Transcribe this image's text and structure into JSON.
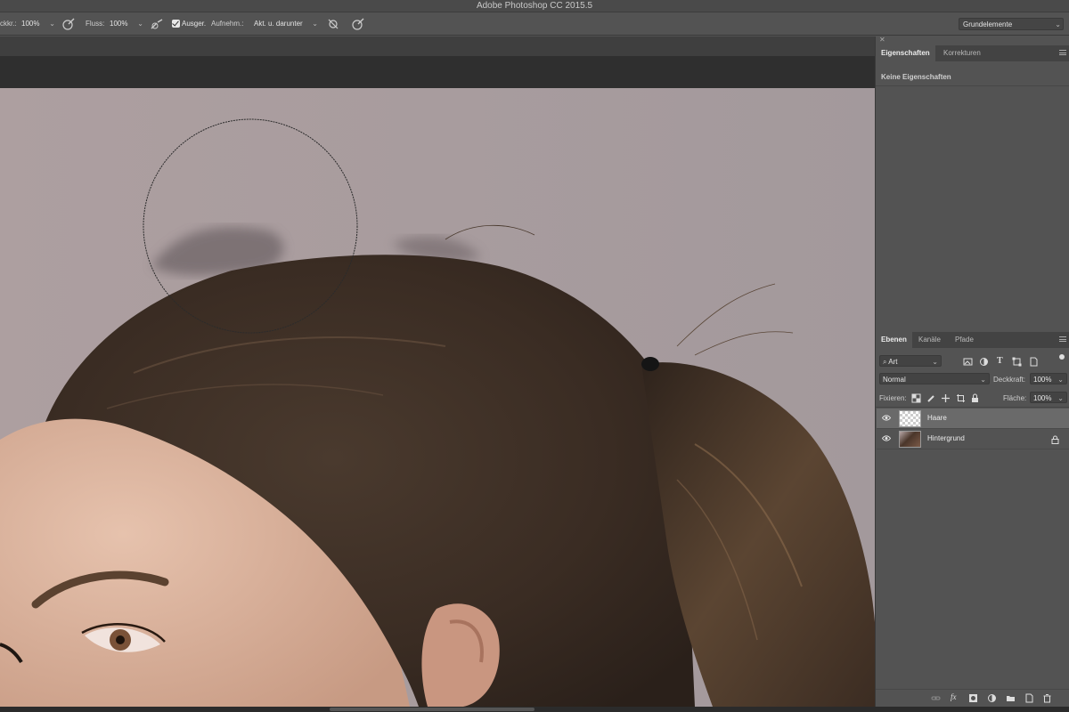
{
  "app": {
    "title": "Adobe Photoshop CC 2015.5"
  },
  "options_bar": {
    "opacity_label": "ckkr.:",
    "opacity_value": "100%",
    "flow_label": "Fluss:",
    "flow_value": "100%",
    "aligned_label": "Ausger.",
    "aligned_checked": true,
    "sample_label": "Aufnehm.:",
    "sample_value": "Akt. u. darunter",
    "workspace": "Grundelemente"
  },
  "properties_panel": {
    "tabs": [
      "Eigenschaften",
      "Korrekturen"
    ],
    "active_tab": "Eigenschaften",
    "message": "Keine Eigenschaften"
  },
  "layers_panel": {
    "tabs": [
      "Ebenen",
      "Kanäle",
      "Pfade"
    ],
    "active_tab": "Ebenen",
    "filter_value": "Art",
    "blend_mode": "Normal",
    "opacity_label": "Deckkraft:",
    "opacity_value": "100%",
    "lock_label": "Fixieren:",
    "fill_label": "Fläche:",
    "fill_value": "100%",
    "layers": [
      {
        "name": "Haare",
        "selected": true,
        "visible": true,
        "locked": false,
        "thumb": "transparent"
      },
      {
        "name": "Hintergrund",
        "selected": false,
        "visible": true,
        "locked": true,
        "thumb": "photo"
      }
    ],
    "footer_icons": [
      "link-icon",
      "fx-icon",
      "mask-icon",
      "adjustment-icon",
      "folder-icon",
      "new-layer-icon",
      "trash-icon"
    ]
  },
  "colors": {
    "canvas_background": "#a8999a",
    "hair": "#3e3027",
    "skin": "#d9b19a",
    "panel": "#535353",
    "selected_layer": "#6a6a6a"
  }
}
